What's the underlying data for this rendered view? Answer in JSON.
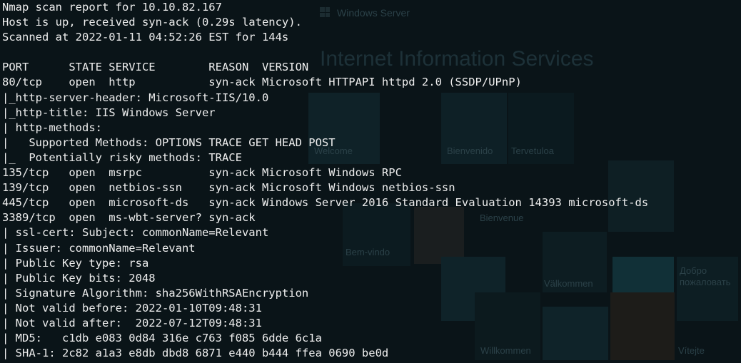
{
  "background": {
    "brand": "Windows Server",
    "title": "Internet Information Services",
    "greetings": [
      "Welcome",
      "Bienvenido",
      "Tervetuloa",
      "Bienvenue",
      "Bem-vindo",
      "Välkommen",
      "Willkommen",
      "Vítejte",
      "Добро пожаловать"
    ]
  },
  "terminal": {
    "lines": [
      "Nmap scan report for 10.10.82.167",
      "Host is up, received syn-ack (0.29s latency).",
      "Scanned at 2022-01-11 04:52:26 EST for 144s",
      "",
      "PORT      STATE SERVICE        REASON  VERSION",
      "80/tcp    open  http           syn-ack Microsoft HTTPAPI httpd 2.0 (SSDP/UPnP)",
      "|_http-server-header: Microsoft-IIS/10.0",
      "|_http-title: IIS Windows Server",
      "| http-methods:",
      "|   Supported Methods: OPTIONS TRACE GET HEAD POST",
      "|_  Potentially risky methods: TRACE",
      "135/tcp   open  msrpc          syn-ack Microsoft Windows RPC",
      "139/tcp   open  netbios-ssn    syn-ack Microsoft Windows netbios-ssn",
      "445/tcp   open  microsoft-ds   syn-ack Windows Server 2016 Standard Evaluation 14393 microsoft-ds",
      "3389/tcp  open  ms-wbt-server? syn-ack",
      "| ssl-cert: Subject: commonName=Relevant",
      "| Issuer: commonName=Relevant",
      "| Public Key type: rsa",
      "| Public Key bits: 2048",
      "| Signature Algorithm: sha256WithRSAEncryption",
      "| Not valid before: 2022-01-10T09:48:31",
      "| Not valid after:  2022-07-12T09:48:31",
      "| MD5:   c1db e083 0d84 316e c763 f085 6dde 6c1a",
      "| SHA-1: 2c82 a1a3 e8db dbd8 6871 e440 b444 ffea 0690 be0d"
    ]
  }
}
